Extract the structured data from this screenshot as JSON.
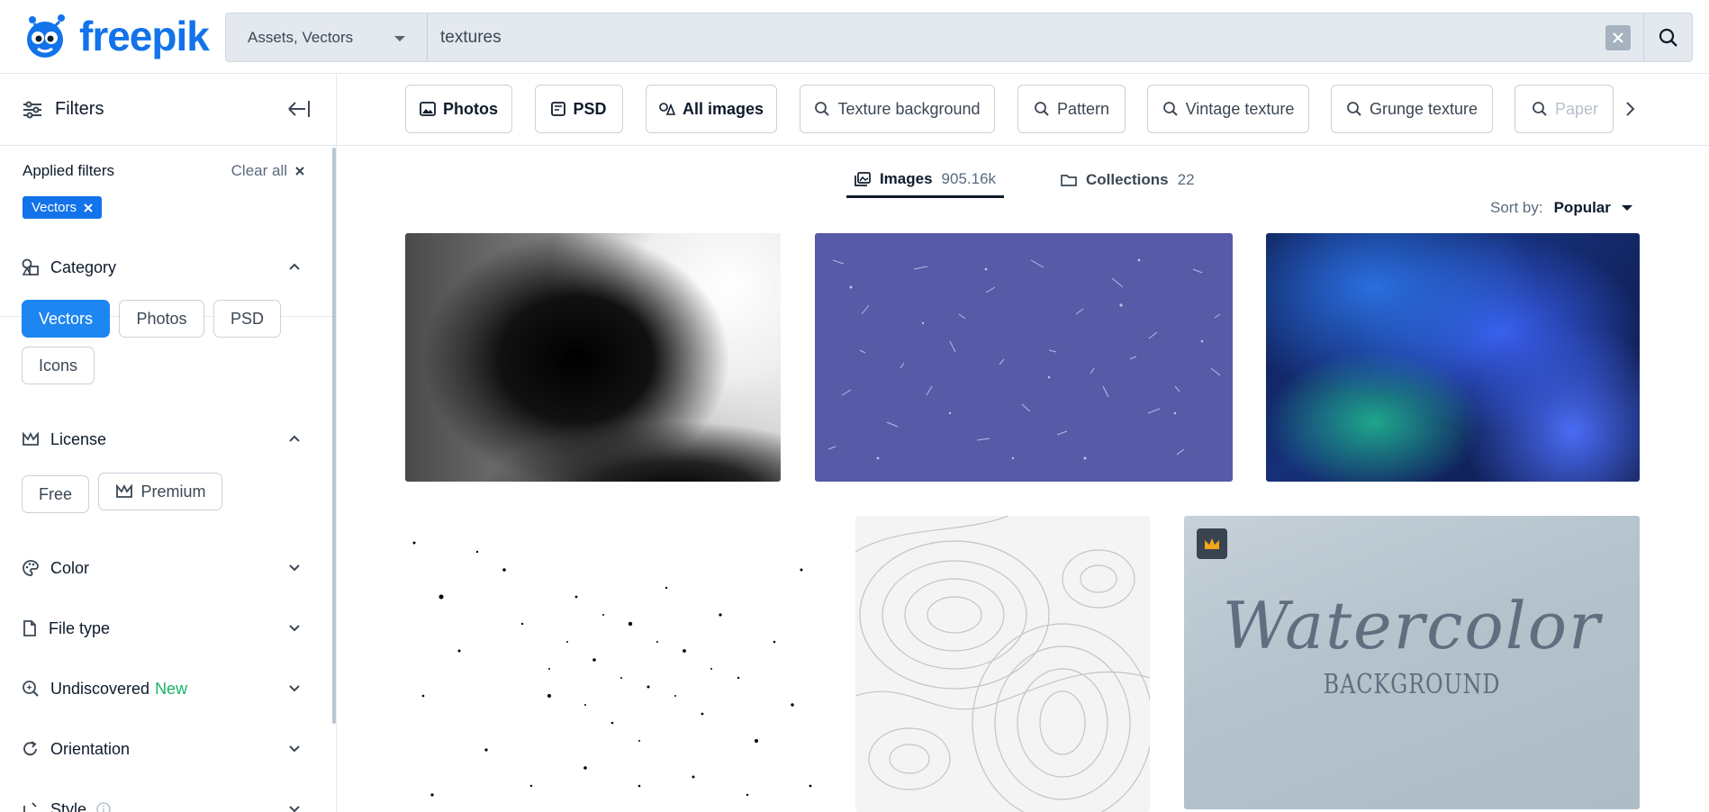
{
  "brand": {
    "name": "freepik",
    "color": "#1273eb"
  },
  "search": {
    "type_label": "Assets, Vectors",
    "query": "textures",
    "clear_icon": "close-icon",
    "submit_icon": "search-icon"
  },
  "sidebar": {
    "title": "Filters",
    "applied_title": "Applied filters",
    "clear_all": "Clear all",
    "applied_chips": [
      "Vectors"
    ],
    "category": {
      "title": "Category",
      "options": [
        {
          "label": "Vectors",
          "active": true
        },
        {
          "label": "Photos",
          "active": false
        },
        {
          "label": "PSD",
          "active": false
        },
        {
          "label": "Icons",
          "active": false
        }
      ]
    },
    "license": {
      "title": "License",
      "options": [
        {
          "label": "Free"
        },
        {
          "label": "Premium"
        }
      ]
    },
    "sections": [
      {
        "title": "Color"
      },
      {
        "title": "File type"
      },
      {
        "title": "Undiscovered",
        "badge": "New"
      },
      {
        "title": "Orientation"
      },
      {
        "title": "Style"
      }
    ]
  },
  "suggestions": [
    {
      "label": "Photos",
      "kind": "type"
    },
    {
      "label": "PSD",
      "kind": "type"
    },
    {
      "label": "All images",
      "kind": "type"
    },
    {
      "label": "Texture background",
      "kind": "search"
    },
    {
      "label": "Pattern",
      "kind": "search"
    },
    {
      "label": "Vintage texture",
      "kind": "search"
    },
    {
      "label": "Grunge texture",
      "kind": "search"
    },
    {
      "label": "Paper",
      "kind": "search"
    }
  ],
  "tabs": [
    {
      "label": "Images",
      "count": "905.16k",
      "active": true
    },
    {
      "label": "Collections",
      "count": "22",
      "active": false
    }
  ],
  "sort": {
    "label": "Sort by:",
    "value": "Popular"
  },
  "results": [
    {
      "name": "black-grain-texture"
    },
    {
      "name": "purple-scratched-texture"
    },
    {
      "name": "blue-gradient-texture"
    },
    {
      "name": "black-speckle-texture"
    },
    {
      "name": "topographic-lines-texture"
    },
    {
      "name": "watercolor-background",
      "premium": true,
      "title": "Watercolor",
      "subtitle": "BACKGROUND"
    }
  ]
}
